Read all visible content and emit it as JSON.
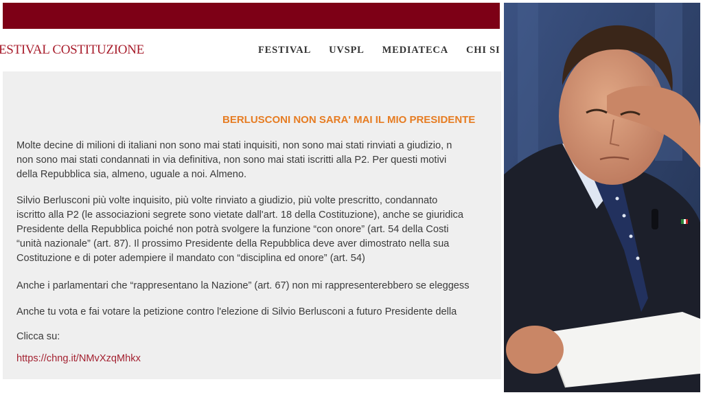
{
  "site": {
    "logo_text": "ESTIVAL COSTITUZIONE",
    "nav": [
      "FESTIVAL",
      "UVSPL",
      "MEDIATECA",
      "CHI SI"
    ]
  },
  "article": {
    "title": "BERLUSCONI NON SARA' MAI IL MIO PRESIDENTE",
    "p1": [
      "Molte decine di milioni di italiani non sono mai stati inquisiti, non sono mai stati rinviati a giudizio, n",
      "non sono mai stati condannati in via definitiva, non sono mai stati iscritti alla P2. Per questi motivi",
      "della Repubblica sia, almeno, uguale a noi. Almeno."
    ],
    "p2": [
      "Silvio Berlusconi più volte inquisito, più volte rinviato a giudizio, più volte prescritto, condannato",
      "iscritto alla P2 (le associazioni segrete sono vietate dall'art. 18 della Costituzione), anche se giuridica",
      "Presidente della Repubblica poiché non potrà svolgere la funzione “con onore” (art. 54 della Costi",
      "“unità nazionale” (art. 87). Il prossimo Presidente della Repubblica deve aver dimostrato nella sua",
      "Costituzione e di poter adempiere il mandato con “disciplina ed onore” (art. 54)"
    ],
    "p3": "Anche i parlamentari che “rappresentano la Nazione” (art. 67) non mi rappresenterebbero se eleggess",
    "p4": "Anche tu vota e fai votare la petizione contro l'elezione di Silvio Berlusconi a futuro Presidente della",
    "p5": "Clicca su:",
    "link": "https://chng.it/NMvXzqMhkx"
  },
  "colors": {
    "top_bar": "#7d0016",
    "logo": "#a81d2c",
    "title": "#e67c22",
    "link": "#a32130",
    "content_bg": "#efefef"
  }
}
